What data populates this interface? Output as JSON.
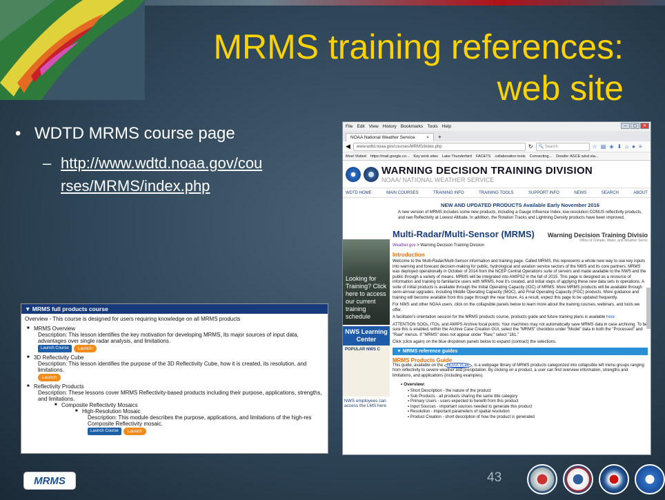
{
  "title_line1": "MRMS training references:",
  "title_line2": "web site",
  "bullet": "WDTD MRMS course page",
  "link_part1": "http://www.wdtd.noaa.gov/cou",
  "link_part2": "rses/MRMS/index.php",
  "course": {
    "header": "MRMS full products course",
    "overview": "Overview - This course is designed for users requiring knowledge on all MRMS products",
    "items": [
      {
        "label": "MRMS Overview",
        "desc": "Description: This lesson identifies the key motivation for developing MRMS, its major sources of input data, advantages over single radar analysis, and limitations."
      },
      {
        "label": "3D Reflectivity Cube",
        "desc": "Description: This lesson identifies the purpose of the 3D Reflectivity Cube, how it is created, its resolution, and limitations."
      },
      {
        "label": "Reflectivity Products",
        "desc": "Description: These lessons cover MRMS Reflectivity-based products including their purpose, applications, strengths, and limitations."
      }
    ],
    "sub": "Composite Reflectivity Mosaics",
    "subsub": "High-Resolution Mosaic",
    "subsub_desc": "Description: This module describes the purpose, applications, and limitations of the high-res Composite Reflectivity mosaic.",
    "launch_course": "Launch Course",
    "launch": "Launch"
  },
  "browser": {
    "menu": [
      "File",
      "Edit",
      "View",
      "History",
      "Bookmarks",
      "Tools",
      "Help"
    ],
    "tab": "NOAA National Weather Service",
    "url": "www.wdtd.noaa.gov/courses/MRMS/index.php",
    "search": "Search",
    "bookmarks": [
      "Most Visited",
      "https://mail.google.co...",
      "Key work sites",
      "Lake Thunderbird",
      "FACETS",
      "collaboration tools",
      "Connecting...",
      "Doodle: ASCE wind sta..."
    ],
    "site_title": "WARNING DECISION TRAINING DIVISION",
    "site_sub": "NOAA/ NATIONAL WEATHER SERVICE",
    "nav": [
      "WDTD HOME",
      "MAIN COURSES",
      "TRAINING INFO",
      "TRAINING TOOLS",
      "SUPPORT INFO",
      "NEWS",
      "SEARCH",
      "ABOUT"
    ],
    "photo_text": "Looking for Training? Click here to access our current training schedule",
    "nws_center": "NWS Learning Center",
    "popular": "POPULAR NWS C",
    "lms": "NWS employees can access the LMS here",
    "new_header": "NEW AND UPDATED PRODUCTS Available Early November 2016",
    "new_text": "A new version of MRMS includes some new products, including a Gauge Influence Index, low-resolution CONUS reflectivity products, and raw Reflectivity at Lowest Altitude. In addition, the Rotation Tracks and Lightning Density products have been improved.",
    "page_title": "Multi-Radar/Multi-Sensor (MRMS)",
    "wdtd_right": "Warning Decision Training Divisio",
    "wdtd_right_sub": "Office of Climate, Water, and Weather Servic",
    "crumb_link": "Weather.gov",
    "crumb_rest": " > Warning Decision Training Division",
    "intro": "Introduction",
    "p1": "Welcome to the Multi-Radar/Multi-Sensor information and training page. Called MRMS, this represents a whole new way to use key inputs into warning and forecast decision-making for public, hydrological and aviation service sectors of the NWS and its core partners. MRMS was deployed operationally in October of 2014 from the NCEP Central Operations suite of servers and made available to the NWS and the public through a variety of means. MRMS will be integrated into AWIPS2 in the fall of 2015. This page is designed as a resource of information and training to familiarize users with MRMS, how it's created, and initial steps of applying these new data sets in operations. A suite of initial products is available through the Initial Operating Capacity (IOC) of MRMS. More MRMS products will be available through semi-annual upgrades, including Middle Operating Capacity (MOC), and Final Operating Capacity (FOC) products. More guidance and training will become available from this page through the near future. As a result, expect this page to be updated frequently.",
    "p2": "For NWS and other NOAA users, click on the collapsible panels below to learn more about the training courses, webinars, and tools we offer.",
    "p3a": "A facilitator's orientation session for the MRMS products course, products guide and future training plans is available ",
    "p3link": "here",
    "p4": "ATTENTION SOOs, ITOs, and AWIPS Archive focal points: Your machines may not automatically save MRMS data in case archiving. To be sure this is enabled, within the Archive Case Creation GUI, select the \"MRMS\" checkbox under \"Model\" data in both the \"Processed\" and \"Raw\" menus. If \"MRMS\" does not appear under \"Raw,\" select \"161.\"",
    "p5": "Click (click again) on the blue dropdown panels below to expand (contract) the selections.",
    "ref_bar": "MRMS reference guides",
    "guide_title": "MRMS Products Guide",
    "guide_a": "This guide, available on the ",
    "guide_link": "NOAA VLab",
    "guide_b": ", is a webpage library of MRMS products categorized into collapsible left menu groups ranging from reflectivity to severe weather and precipitation. By clicking on a product, a user can find overview information, strengths and limitations, and applications (including examples).",
    "overview": "Overview:",
    "list": [
      "Short Description - the nature of the product",
      "Sub Products - all products sharing the same title category",
      "Primary Users - users expected to benefit from this product",
      "Input Sources - important sources needed to generate this product",
      "Resolution - important parameters of spatial resolution",
      "Product Creation - short description of how the product is generated"
    ]
  },
  "footer": {
    "badge": "MRMS",
    "page": "43"
  },
  "colors": {
    "title": "#ffd200",
    "course_header": "#173a7a",
    "launch": "#f18b1c"
  }
}
